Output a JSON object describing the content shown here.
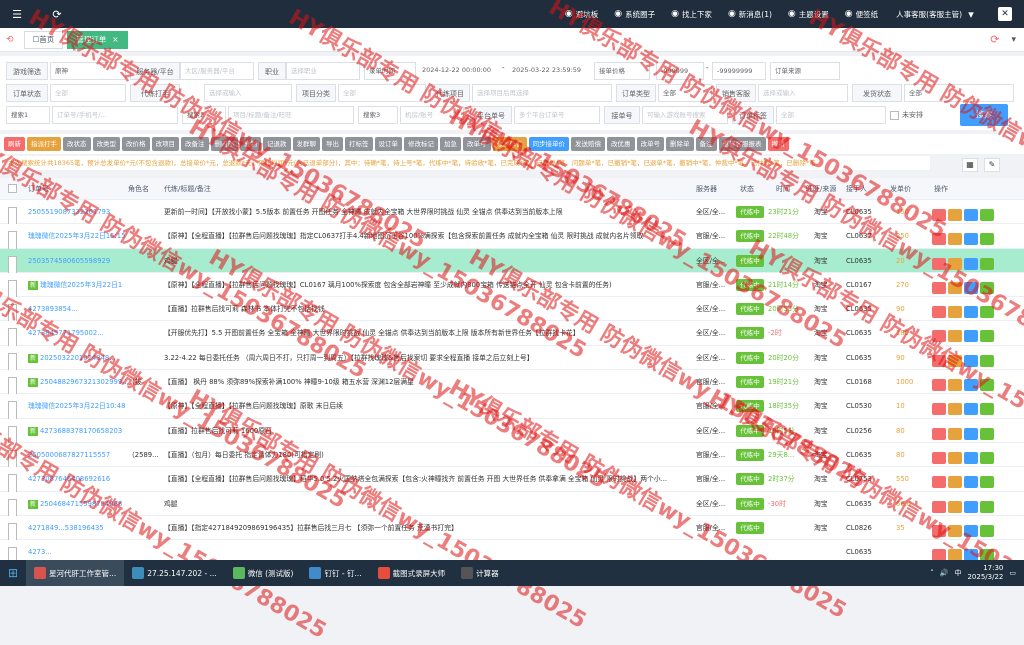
{
  "topbar": {
    "nav": [
      {
        "icon": "gamepad-icon",
        "label": "避坑板"
      },
      {
        "icon": "circle-icon",
        "label": "系统圈子"
      },
      {
        "icon": "up-icon",
        "label": "找上下家"
      },
      {
        "icon": "bell-icon",
        "label": "新消息(1)"
      },
      {
        "icon": "palette-icon",
        "label": "主题设置"
      },
      {
        "icon": "note-icon",
        "label": "便签纸"
      }
    ],
    "user": "人事客服(客服主管)"
  },
  "tabs": [
    {
      "label": "首页",
      "prefix": "☐ "
    },
    {
      "label": "管理订单",
      "active": true
    }
  ],
  "filters": {
    "row1": {
      "game_label": "游戏筛选",
      "game_value": "原神",
      "server_label": "服务器/平台",
      "server_placeholder": "大区/服务器/平台",
      "job_label": "职业",
      "job_placeholder": "选择职业",
      "time_select": "录单时间",
      "date_start": "2024-12-22 00:00:00",
      "date_sep": "-",
      "date_end": "2025-03-22 23:59:59",
      "price_select": "接单价格",
      "price_min": "-999999",
      "price_sep": "-",
      "price_max": "-99999999",
      "source_placeholder": "订单来源"
    },
    "row2": {
      "status_label": "订单状态",
      "status_value": "全部",
      "agent_label": "代练打手",
      "agent_placeholder": "选择或输入",
      "project_label": "项目分类",
      "project_placeholder": "全部",
      "item_label": "代练项目",
      "item_placeholder": "选择项目后再选择",
      "type_label": "订单类型",
      "type_value": "全部",
      "sales_label": "销售客服",
      "sales_placeholder": "选择或输入",
      "extra_label": "发货状态",
      "extra_value": "全部"
    },
    "row3": {
      "search1_select": "搜索1",
      "search1_placeholder": "订单号/手机号/...",
      "search2_select": "搜索2",
      "search2_placeholder": "项目/标题/备注/旺旺",
      "search3_select": "搜索3",
      "search3_placeholder": "机房/账号",
      "platform_label": "平台单号",
      "platform_placeholder": "多个平台订单号",
      "receipt_label": "接单号",
      "receipt_placeholder": "可输入游戏账号搜索",
      "order_tag_label": "订单标签",
      "order_tag_value": "全部",
      "unassigned": "未安排",
      "search_button": "搜索"
    }
  },
  "actions": [
    {
      "label": "刷新",
      "color": "#f56c6c"
    },
    {
      "label": "指派打手",
      "color": "#e6a23c"
    },
    {
      "label": "改状态",
      "color": "#909399"
    },
    {
      "label": "改类型",
      "color": "#909399"
    },
    {
      "label": "改价格",
      "color": "#909399"
    },
    {
      "label": "改项目",
      "color": "#909399"
    },
    {
      "label": "改备注",
      "color": "#909399"
    },
    {
      "label": "删内部",
      "color": "#909399"
    },
    {
      "label": "复制",
      "color": "#909399"
    },
    {
      "label": "记退款",
      "color": "#909399"
    },
    {
      "label": "发群聊",
      "color": "#909399"
    },
    {
      "label": "导出",
      "color": "#909399"
    },
    {
      "label": "打标签",
      "color": "#909399"
    },
    {
      "label": "设订单",
      "color": "#909399"
    },
    {
      "label": "修改标记",
      "color": "#909399"
    },
    {
      "label": "加急",
      "color": "#909399"
    },
    {
      "label": "改单号",
      "color": "#909399"
    },
    {
      "label": "改发单价",
      "color": "#e6a23c"
    },
    {
      "label": "同步接单价",
      "color": "#409eff"
    },
    {
      "label": "发送赔偿",
      "color": "#909399"
    },
    {
      "label": "改优惠",
      "color": "#909399"
    },
    {
      "label": "改单号",
      "color": "#909399"
    },
    {
      "label": "删除单",
      "color": "#909399"
    },
    {
      "label": "备注",
      "color": "#909399"
    },
    {
      "label": "重算客服报表",
      "color": "#909399"
    },
    {
      "label": "撤销",
      "color": "#f56c6c"
    }
  ],
  "summary": "本次搜索统计共18365笔，预计总发单价*元(不包含退款)，总接单价*元，总退款*元，预计利润*元(含已退单部分)，其中：待确*笔，待上号*笔，代练中*笔，待验收*笔，已完成*笔，已暂停*笔，问题单*笔，已撤销*笔，已退单*笔，撤销中*笔，仲裁中*笔，已仲裁*笔，已删除*笔",
  "table": {
    "headers": [
      "订单号",
      "角色名",
      "代练/标题/备注",
      "服务器",
      "状态",
      "时间",
      "旺旺/来源",
      "接手人",
      "发单价",
      "操作"
    ],
    "rows": [
      {
        "order": "2505519087332261793",
        "tag": "",
        "role": "",
        "title": "更新前一时间】【开放找小蒙】5.5版本 前置任务 开图任务 全神瞳 成就内全宝箱 大世界限时挑战 仙灵 全锚点 供奉达到当前版本上限",
        "server": "全区/全...",
        "status": "代练中",
        "time": "23时21分",
        "time_red": false,
        "source": "淘宝",
        "agent": "CL0635",
        "fee": "150",
        "hl": false
      },
      {
        "order": "瑰瑰微信2025年3月22日15:15",
        "tag": "",
        "role": "",
        "title": "【原神】【全程直播】【拉群售后问题找瑰瑰】指定CL0637打手4.4新地图沉玉谷100%满探索【包含探索前置任务 成就内全宝箱 仙灵 限时挑战 成就内名片领取",
        "server": "官服/全...",
        "status": "代练中",
        "time": "22时48分",
        "time_red": false,
        "source": "淘宝",
        "agent": "CL0637",
        "fee": "250",
        "hl": false
      },
      {
        "order": "2503574580605598929",
        "tag": "",
        "role": "",
        "title": "鸡腿",
        "server": "全区/全...",
        "status": "代练中",
        "time": "",
        "time_red": false,
        "source": "淘宝",
        "agent": "CL0635",
        "fee": "20",
        "hl": true
      },
      {
        "order": "瑰瑰微信2025年3月22日1",
        "tag": "新",
        "role": "",
        "title": "【原神】【全程直播】【拉群售后问题找瑰瑰】CL0167 璃月100%探索度 包含全部岩神瞳 至少成就内800宝箱 传送锚点全开 仙灵 包含卡前置的任务)",
        "server": "官服/全...",
        "status": "代练中",
        "time": "21时14分",
        "time_red": false,
        "source": "淘宝",
        "agent": "CL0167",
        "fee": "270",
        "hl": false
      },
      {
        "order": "4273893854...",
        "tag": "",
        "role": "",
        "title": "【直播】拉群售后找可莉 森林书 本体打完不包括找钱",
        "server": "全区/全...",
        "status": "代练中",
        "time": "20时53分",
        "time_red": false,
        "source": "淘宝",
        "agent": "CL0635",
        "fee": "90",
        "hl": false
      },
      {
        "order": "4273845771795002...",
        "tag": "",
        "role": "",
        "title": "【开服优先打】5.5 开图前置任务 全宝箱 全神瞳 大世界限时挑战 仙灵 全锚点 供奉达到当前版本上限 版本所有新世界任务【拉群找卡花】",
        "server": "全区/全...",
        "status": "代练中",
        "time": "-2时",
        "time_red": true,
        "source": "淘宝",
        "agent": "CL0635",
        "fee": "180",
        "hl": false
      },
      {
        "order": "2025032201024348...",
        "tag": "新",
        "role": "",
        "title": "3.22-4.22 每日委托任务 （周六周日不打，只打周一到周五）【拉群找瑰瑰&售后找案切 要求全程直播 接单之后立刻上号】",
        "server": "全区/全...",
        "status": "代练中",
        "time": "20时20分",
        "time_red": false,
        "source": "淘宝",
        "agent": "CL0635",
        "fee": "90",
        "hl": false
      },
      {
        "order": "2504882967321302999,2",
        "tag": "新",
        "role": "（拔",
        "title": "【直播】 枫丹 88% 须弥89%探索补满100% 神瞳9-10级 箱五水营 深渊12层满星",
        "server": "官服/全...",
        "status": "代练中",
        "time": "19时21分",
        "time_red": false,
        "source": "淘宝",
        "agent": "CL0168",
        "fee": "1000",
        "hl": false
      },
      {
        "order": "瑰瑰微信2025年3月22日10:48",
        "tag": "",
        "role": "",
        "title": "【原神】【全程直播】【拉群售后问题找瑰瑰】原歌 末日后续",
        "server": "官服/全...",
        "status": "代练中",
        "time": "18时35分",
        "time_red": false,
        "source": "淘宝",
        "agent": "CL0530",
        "fee": "10",
        "hl": false
      },
      {
        "order": "4273688378170658203",
        "tag": "新",
        "role": "",
        "title": "【直播】拉群售后找可莉 1600原石",
        "server": "全区/全...",
        "status": "代练中",
        "time": "18时5分",
        "time_red": false,
        "source": "淘宝",
        "agent": "CL0256",
        "fee": "80",
        "hl": false
      },
      {
        "order": "2505000687827115557",
        "tag": "",
        "role": "（2589...",
        "title": "【直播】（包月）每日委托 指定请体力180(可指定刷)",
        "server": "官服/全...",
        "status": "代练中",
        "time": "29天8...",
        "time_red": false,
        "source": "淘宝",
        "agent": "CL0635",
        "fee": "80",
        "hl": false
      },
      {
        "order": "4273087646408692616",
        "tag": "",
        "role": "",
        "title": "【直播】【全程直播】【拉群售后问题找瑰瑰】稻华5.0 5.2火国纳塔全包满探索【包含:火神瞳找齐 前置任务 开图 大世界任务 供奉拿满 全宝箱 仙灵 限时挑战】两个小...",
        "server": "官服/全...",
        "status": "代练中",
        "time": "2时37分",
        "time_red": false,
        "source": "淘宝",
        "agent": "CL0753",
        "fee": "550",
        "hl": false
      },
      {
        "order": "2504684715598754068",
        "tag": "新",
        "role": "",
        "title": "鸡腿",
        "server": "全区/全...",
        "status": "代练中",
        "time": "-30时",
        "time_red": true,
        "source": "淘宝",
        "agent": "CL0635",
        "fee": "66.6",
        "hl": false
      },
      {
        "order": "4271849...538196435",
        "tag": "",
        "role": "",
        "title": "【直播】【指定4271849209869196435】拉群售后找三月七 【须弥一个前置任务 荒漠书打完】",
        "server": "官服/全...",
        "status": "代练中",
        "time": "",
        "time_red": false,
        "source": "淘宝",
        "agent": "CL0826",
        "fee": "35",
        "hl": false
      },
      {
        "order": "4273...",
        "tag": "",
        "role": "",
        "title": "",
        "server": "",
        "status": "",
        "time": "",
        "time_red": false,
        "source": "",
        "agent": "CL0635",
        "fee": "",
        "hl": false
      }
    ]
  },
  "watermark": "HY俱乐部专用 防伪微信wy_15036788025",
  "taskbar": {
    "items": [
      {
        "label": "星河代肝工作室管...",
        "color": "#d9534f",
        "active": true
      },
      {
        "label": "27.25.147.202 - ...",
        "color": "#3c8dbc",
        "active": false
      },
      {
        "label": "微信 (测试版)",
        "color": "#5cb85c",
        "active": false
      },
      {
        "label": "钉钉 - 钉...",
        "color": "#428bca",
        "active": false
      },
      {
        "label": "截图式录屏大师",
        "color": "#e74c3c",
        "active": false
      },
      {
        "label": "计算器",
        "color": "#555",
        "active": false
      }
    ],
    "time": "17:30",
    "date": "2025/3/22"
  }
}
